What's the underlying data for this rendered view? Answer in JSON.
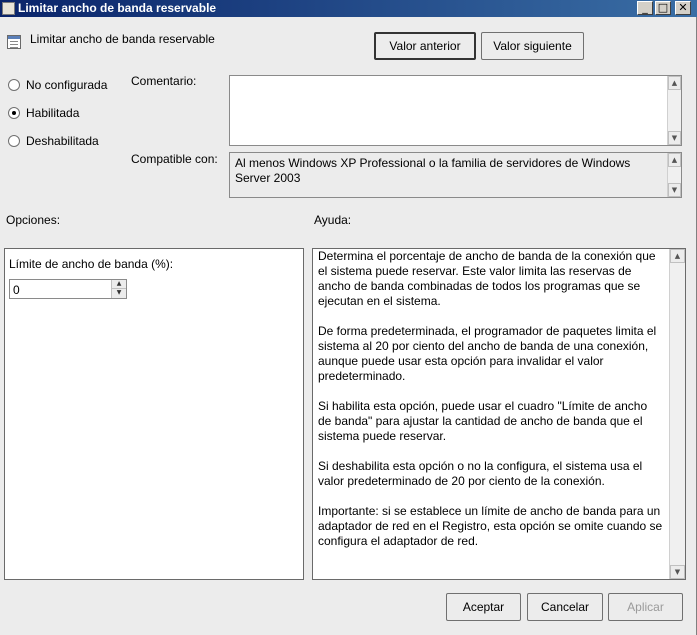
{
  "window": {
    "title": "Limitar ancho de banda reservable",
    "controls": {
      "minimize": "_",
      "maximize": "□",
      "close": "✕"
    }
  },
  "header": {
    "policy_name": "Limitar ancho de banda reservable",
    "prev_label": "Valor anterior",
    "next_label": "Valor siguiente"
  },
  "state": {
    "options": [
      {
        "label": "No configurada",
        "selected": false
      },
      {
        "label": "Habilitada",
        "selected": true
      },
      {
        "label": "Deshabilitada",
        "selected": false
      }
    ]
  },
  "comment": {
    "label": "Comentario:",
    "value": ""
  },
  "compatible": {
    "label": "Compatible con:",
    "value": "Al menos Windows XP Professional o la familia de servidores de Windows Server 2003"
  },
  "options_section": {
    "label": "Opciones:",
    "field_label": "Límite de ancho de banda (%):",
    "field_value": "0"
  },
  "help_section": {
    "label": "Ayuda:",
    "paragraphs": [
      "Determina el porcentaje de ancho de banda de la conexión que el sistema puede reservar. Este valor limita las reservas de ancho de banda combinadas de todos los programas que se ejecutan en el sistema.",
      "De forma predeterminada, el programador de paquetes limita el sistema al 20 por ciento del ancho de banda de una conexión, aunque puede usar esta opción para invalidar el valor predeterminado.",
      "Si habilita esta opción, puede usar el cuadro \"Límite de ancho de banda\" para ajustar la cantidad de ancho de banda que el sistema puede reservar.",
      "Si deshabilita esta opción o no la configura, el sistema usa el valor predeterminado de 20 por ciento de la conexión.",
      "Importante: si se establece un límite de ancho de banda para un adaptador de red en el Registro, esta opción se omite cuando se configura el adaptador de red."
    ]
  },
  "footer": {
    "ok_label": "Aceptar",
    "cancel_label": "Cancelar",
    "apply_label": "Aplicar"
  }
}
